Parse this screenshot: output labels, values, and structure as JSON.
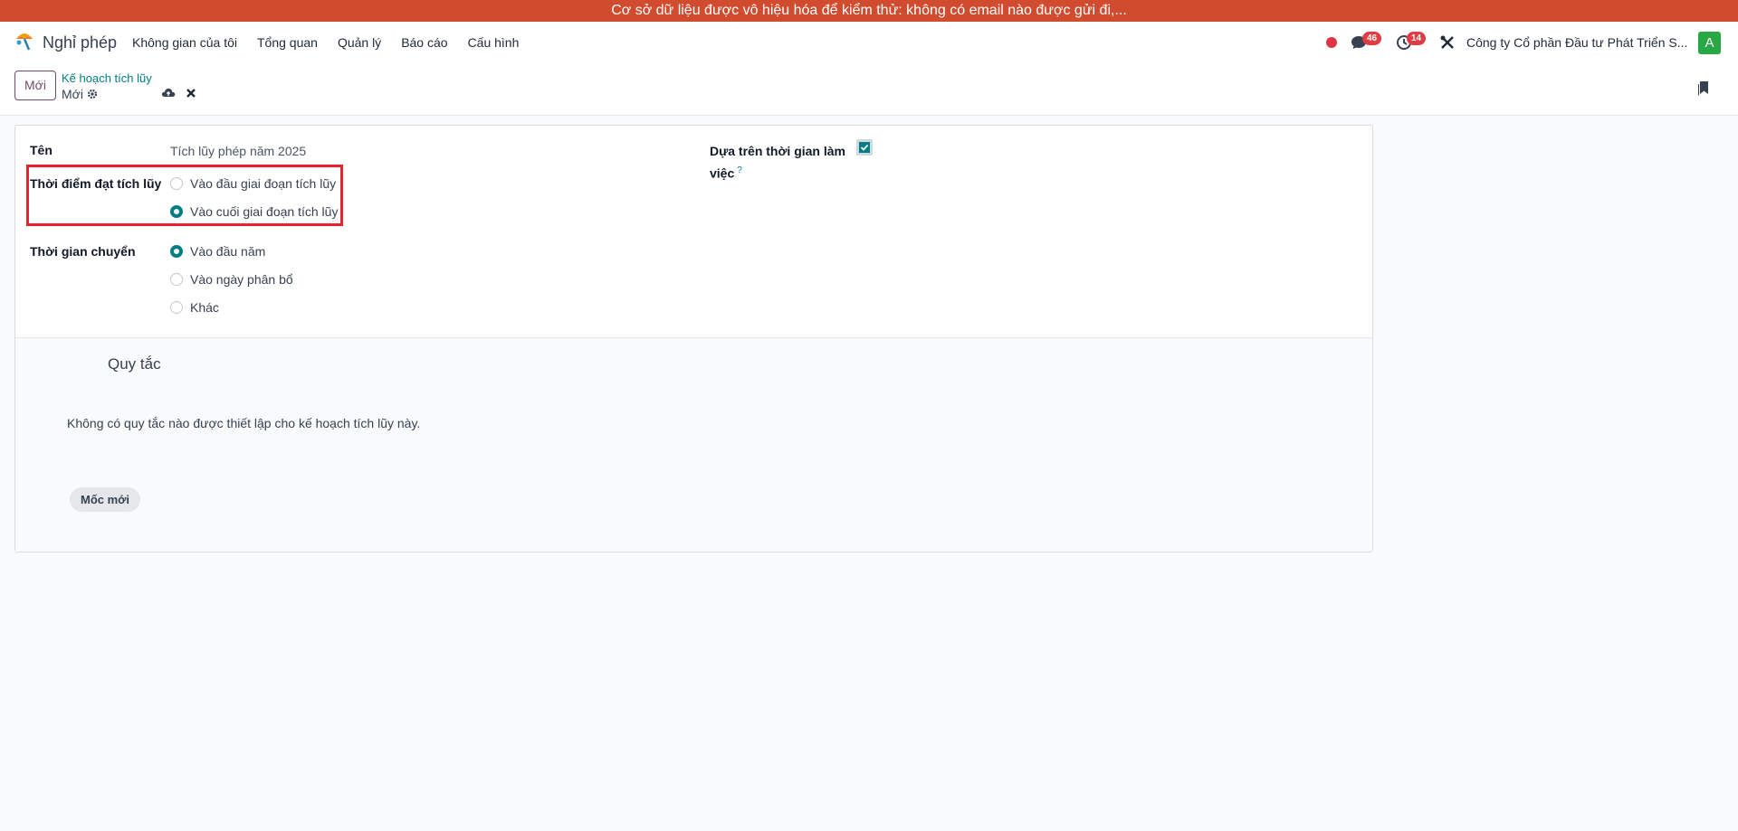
{
  "banner": {
    "text": "Cơ sở dữ liệu được vô hiệu hóa để kiểm thử: không có email nào được gửi đi,..."
  },
  "navbar": {
    "app_name": "Nghỉ phép",
    "menu": [
      "Không gian của tôi",
      "Tổng quan",
      "Quản lý",
      "Báo cáo",
      "Cấu hình"
    ],
    "messages_count": "46",
    "activities_count": "14",
    "company": "Công ty Cổ phần Đầu tư Phát Triển S...",
    "avatar_letter": "A"
  },
  "control": {
    "new_label": "Mới",
    "breadcrumb": "Kế hoạch tích lũy",
    "record_name": "Mới"
  },
  "form": {
    "name_label": "Tên",
    "name_value": "Tích lũy phép năm 2025",
    "accrual_time_label": "Thời điểm đạt tích lũy",
    "accrual_time_options": [
      {
        "label": "Vào đầu giai đoạn tích lũy",
        "checked": false
      },
      {
        "label": "Vào cuối giai đoạn tích lũy",
        "checked": true
      }
    ],
    "carryover_label": "Thời gian chuyển",
    "carryover_options": [
      {
        "label": "Vào đầu năm",
        "checked": true
      },
      {
        "label": "Vào ngày phân bổ",
        "checked": false
      },
      {
        "label": "Khác",
        "checked": false
      }
    ],
    "worked_time_label_line1": "Dựa trên thời gian làm",
    "worked_time_label_line2": "việc",
    "worked_time_help": "?",
    "worked_time_checked": true
  },
  "rules": {
    "title": "Quy tắc",
    "empty_text": "Không có quy tắc nào được thiết lập cho kế hoạch tích lũy này.",
    "new_milestone_label": "Mốc mới"
  },
  "colors": {
    "banner": "#d14b2f",
    "primary": "#714b67",
    "accent": "#017e84",
    "highlight": "#e8232f"
  },
  "icons": [
    "app-logo-icon",
    "chat-icon",
    "clock-icon",
    "tools-icon",
    "gear-icon",
    "cloud-upload-icon",
    "close-icon",
    "bookmark-icon",
    "check-icon"
  ]
}
